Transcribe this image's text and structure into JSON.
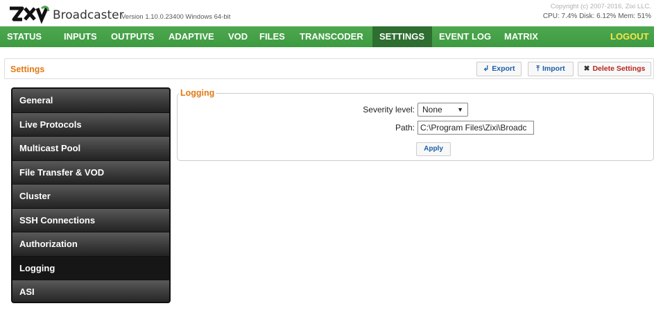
{
  "header": {
    "app_name": "Broadcaster",
    "version": "Version 1.10.0.23400 Windows 64-bit",
    "copyright": "Copyright (c) 2007-2016, Zixi LLC.",
    "stats": "CPU: 7.4%  Disk: 6.12%  Mem: 51%"
  },
  "nav": {
    "items": [
      "STATUS",
      "INPUTS",
      "OUTPUTS",
      "ADAPTIVE",
      "VOD",
      "FILES",
      "TRANSCODER",
      "SETTINGS",
      "EVENT LOG",
      "MATRIX"
    ],
    "active": "SETTINGS",
    "logout": "LOGOUT"
  },
  "toolbar": {
    "title": "Settings",
    "export_label": "Export",
    "import_label": "Import",
    "delete_label": "Delete Settings"
  },
  "sidebar": {
    "items": [
      {
        "label": "General"
      },
      {
        "label": "Live Protocols"
      },
      {
        "label": "Multicast Pool"
      },
      {
        "label": "File Transfer & VOD"
      },
      {
        "label": "Cluster"
      },
      {
        "label": "SSH Connections"
      },
      {
        "label": "Authorization"
      },
      {
        "label": "Logging"
      },
      {
        "label": "ASI"
      }
    ],
    "active": "Logging"
  },
  "logging": {
    "legend": "Logging",
    "severity_label": "Severity level:",
    "severity_value": "None",
    "path_label": "Path:",
    "path_value": "C:\\Program Files\\Zixi\\Broadc",
    "apply_label": "Apply"
  },
  "colors": {
    "nav_bg": "#46a249",
    "nav_active": "#2e6e30",
    "logout": "#f6e84a",
    "accent_orange": "#e07a13",
    "link_blue": "#1a5fa6"
  }
}
